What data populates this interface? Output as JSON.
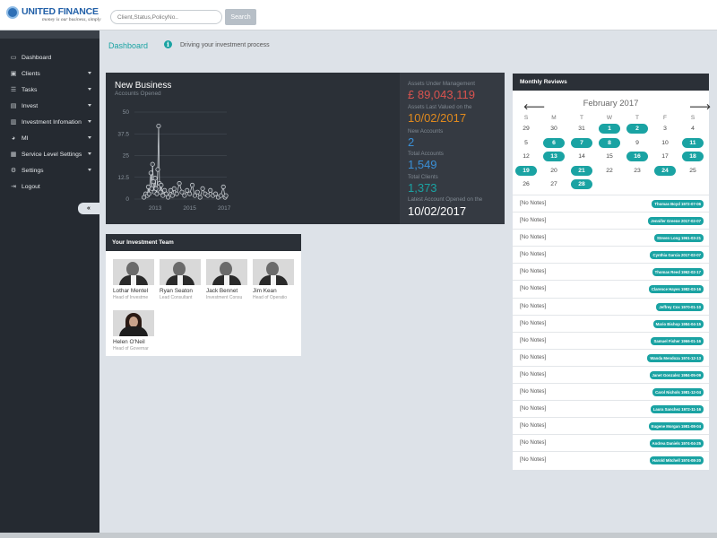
{
  "brand": {
    "name": "UNITED FINANCE",
    "tagline": "money is our business, simply"
  },
  "search": {
    "placeholder": "Client,Status,PolicyNo..",
    "button_label": "Search"
  },
  "sidebar": {
    "items": [
      {
        "label": "Dashboard",
        "icon": "monitor-icon",
        "has_submenu": false
      },
      {
        "label": "Clients",
        "icon": "briefcase-icon",
        "has_submenu": true
      },
      {
        "label": "Tasks",
        "icon": "tasks-icon",
        "has_submenu": true
      },
      {
        "label": "Invest",
        "icon": "document-icon",
        "has_submenu": true
      },
      {
        "label": "Investment Infomation",
        "icon": "chart-icon",
        "has_submenu": true
      },
      {
        "label": "MI",
        "icon": "pie-chart-icon",
        "has_submenu": true
      },
      {
        "label": "Service Level Settings",
        "icon": "calendar-icon",
        "has_submenu": true
      },
      {
        "label": "Settings",
        "icon": "gear-icon",
        "has_submenu": true
      },
      {
        "label": "Logout",
        "icon": "logout-icon",
        "has_submenu": false
      }
    ],
    "collapse_label": "«"
  },
  "header": {
    "breadcrumb": "Dashboard",
    "info_icon": "info-icon",
    "subtitle": "Driving your investment process"
  },
  "new_business": {
    "title": "New Business",
    "subtitle": "Accounts Opened",
    "stats": [
      {
        "label": "Assets Under Management",
        "value": "£ 89,043,119",
        "color": "#d9534f"
      },
      {
        "label": "Assets Last Valued on the",
        "value": "10/02/2017",
        "color": "#e08a1e"
      },
      {
        "label": "New Accounts",
        "value": "2",
        "color": "#3a8fd6"
      },
      {
        "label": "Total Accounts",
        "value": "1,549",
        "color": "#3a8fd6"
      },
      {
        "label": "Total Clients",
        "value": "1,373",
        "color": "#1aa3a3"
      },
      {
        "label": "Latest Account Opened on the",
        "value": "10/02/2017",
        "color": "#ffffff"
      }
    ]
  },
  "chart_data": {
    "type": "line",
    "title": "New Business",
    "subtitle": "Accounts Opened",
    "y_ticks": [
      "50",
      "37.5",
      "25",
      "12.5",
      "0"
    ],
    "x_ticks": [
      "2013",
      "2015",
      "2017"
    ],
    "ylim": [
      0,
      50
    ],
    "xlim": [
      2011.8,
      2017.25
    ],
    "grid": true,
    "series": [
      {
        "values": [
          [
            2012.35,
            1
          ],
          [
            2012.45,
            3
          ],
          [
            2012.55,
            2
          ],
          [
            2012.6,
            7
          ],
          [
            2012.65,
            3
          ],
          [
            2012.75,
            15
          ],
          [
            2012.8,
            6
          ],
          [
            2012.85,
            20
          ],
          [
            2012.9,
            10
          ],
          [
            2012.95,
            4
          ],
          [
            2013.0,
            12
          ],
          [
            2013.05,
            6
          ],
          [
            2013.1,
            3
          ],
          [
            2013.15,
            17
          ],
          [
            2013.2,
            42
          ],
          [
            2013.25,
            9
          ],
          [
            2013.3,
            4
          ],
          [
            2013.35,
            8
          ],
          [
            2013.45,
            2
          ],
          [
            2013.55,
            5
          ],
          [
            2013.65,
            3
          ],
          [
            2013.75,
            1
          ],
          [
            2013.9,
            5
          ],
          [
            2014.0,
            2
          ],
          [
            2014.1,
            6
          ],
          [
            2014.25,
            3
          ],
          [
            2014.4,
            9
          ],
          [
            2014.55,
            4
          ],
          [
            2014.7,
            2
          ],
          [
            2014.85,
            5
          ],
          [
            2015.0,
            3
          ],
          [
            2015.15,
            8
          ],
          [
            2015.3,
            2
          ],
          [
            2015.45,
            4
          ],
          [
            2015.6,
            1
          ],
          [
            2015.75,
            6
          ],
          [
            2015.9,
            3
          ],
          [
            2016.05,
            2
          ],
          [
            2016.2,
            5
          ],
          [
            2016.35,
            2
          ],
          [
            2016.5,
            3
          ],
          [
            2016.65,
            1
          ],
          [
            2016.8,
            2
          ],
          [
            2016.95,
            7
          ],
          [
            2017.05,
            1
          ],
          [
            2017.1,
            2
          ]
        ]
      }
    ]
  },
  "team": {
    "title": "Your Investment Team",
    "members": [
      {
        "name": "Lothar Mentel",
        "role": "Head of Investme",
        "gender": "m"
      },
      {
        "name": "Ryan Seaton",
        "role": "Lead Consultant",
        "gender": "m"
      },
      {
        "name": "Jack Bennet",
        "role": "Investment Consu",
        "gender": "m"
      },
      {
        "name": "Jim Kean",
        "role": "Head of Operatio",
        "gender": "m"
      },
      {
        "name": "Helen O'Neil",
        "role": "Head of Governar",
        "gender": "f"
      }
    ]
  },
  "reviews": {
    "title": "Monthly Reviews",
    "month": "February 2017",
    "weekdays": [
      "S",
      "M",
      "T",
      "W",
      "T",
      "F",
      "S"
    ],
    "weeks": [
      [
        "29",
        "30",
        "31",
        "1",
        "2",
        "3",
        "4"
      ],
      [
        "5",
        "6",
        "7",
        "8",
        "9",
        "10",
        "11"
      ],
      [
        "12",
        "13",
        "14",
        "15",
        "16",
        "17",
        "18"
      ],
      [
        "19",
        "20",
        "21",
        "22",
        "23",
        "24",
        "25"
      ],
      [
        "26",
        "27",
        "28",
        "",
        "",
        "",
        ""
      ]
    ],
    "highlighted_days": [
      "1",
      "2",
      "6",
      "7",
      "8",
      "11",
      "13",
      "16",
      "18",
      "19",
      "21",
      "24",
      "28"
    ],
    "rows": [
      {
        "note": "[No Notes]",
        "client": "Thomas Boyd 1972-07-06"
      },
      {
        "note": "[No Notes]",
        "client": "Jennifer Greene 2017-02-07"
      },
      {
        "note": "[No Notes]",
        "client": "Steven Long 1961-03-21"
      },
      {
        "note": "[No Notes]",
        "client": "Cynthia Garcia 2017-02-07"
      },
      {
        "note": "[No Notes]",
        "client": "Thomas Reed 1962-02-17"
      },
      {
        "note": "[No Notes]",
        "client": "Clarence Hayes 1982-03-16"
      },
      {
        "note": "[No Notes]",
        "client": "Jeffrey Cox 1970-01-10"
      },
      {
        "note": "[No Notes]",
        "client": "Mario Bishop 1984-04-15"
      },
      {
        "note": "[No Notes]",
        "client": "Samuel Fisher 1966-01-16"
      },
      {
        "note": "[No Notes]",
        "client": "Wanda Mendoza 1974-12-13"
      },
      {
        "note": "[No Notes]",
        "client": "Janet Gonzalez 1984-05-09"
      },
      {
        "note": "[No Notes]",
        "client": "Carol Nichols 1981-12-04"
      },
      {
        "note": "[No Notes]",
        "client": "Laura Sanchez 1972-11-16"
      },
      {
        "note": "[No Notes]",
        "client": "Eugene Morgan 1981-08-04"
      },
      {
        "note": "[No Notes]",
        "client": "Andrea Daniels 1974-04-25"
      },
      {
        "note": "[No Notes]",
        "client": "Harold Mitchell 1974-08-20"
      }
    ]
  },
  "colors": {
    "accent": "#1aa3a3",
    "sidebar": "#252a31",
    "panel_dark": "#2b3037"
  }
}
